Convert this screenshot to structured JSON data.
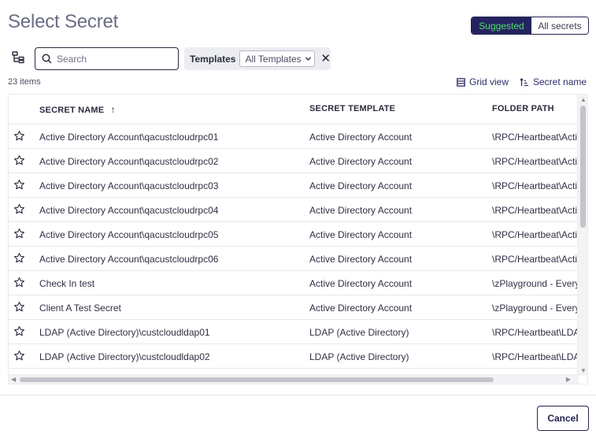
{
  "dialog": {
    "title": "Select Secret"
  },
  "toggle": {
    "suggested_label": "Suggested",
    "all_label": "All secrets"
  },
  "search": {
    "placeholder": "Search",
    "value": ""
  },
  "filter": {
    "label": "Templates",
    "selected": "All Templates"
  },
  "results": {
    "count_text": "23 items"
  },
  "view_controls": {
    "grid_view_label": "Grid view",
    "sort_label": "Secret name"
  },
  "table": {
    "columns": [
      "SECRET NAME",
      "SECRET TEMPLATE",
      "FOLDER PATH"
    ],
    "sort_indicator": "↑",
    "rows": [
      {
        "name": "Active Directory Account\\qacustcloudrpc01",
        "template": "Active Directory Account",
        "folder": "\\RPC/Heartbeat\\Active"
      },
      {
        "name": "Active Directory Account\\qacustcloudrpc02",
        "template": "Active Directory Account",
        "folder": "\\RPC/Heartbeat\\Active"
      },
      {
        "name": "Active Directory Account\\qacustcloudrpc03",
        "template": "Active Directory Account",
        "folder": "\\RPC/Heartbeat\\Active"
      },
      {
        "name": "Active Directory Account\\qacustcloudrpc04",
        "template": "Active Directory Account",
        "folder": "\\RPC/Heartbeat\\Active"
      },
      {
        "name": "Active Directory Account\\qacustcloudrpc05",
        "template": "Active Directory Account",
        "folder": "\\RPC/Heartbeat\\Active"
      },
      {
        "name": "Active Directory Account\\qacustcloudrpc06",
        "template": "Active Directory Account",
        "folder": "\\RPC/Heartbeat\\Active"
      },
      {
        "name": "Check In test",
        "template": "Active Directory Account",
        "folder": "\\zPlayground - Everyone"
      },
      {
        "name": "Client A Test Secret",
        "template": "Active Directory Account",
        "folder": "\\zPlayground - Everyone"
      },
      {
        "name": "LDAP (Active Directory)\\custcloudldap01",
        "template": "LDAP (Active Directory)",
        "folder": "\\RPC/Heartbeat\\LDAP"
      },
      {
        "name": "LDAP (Active Directory)\\custcloudldap02",
        "template": "LDAP (Active Directory)",
        "folder": "\\RPC/Heartbeat\\LDAP"
      }
    ]
  },
  "footer": {
    "cancel_label": "Cancel"
  },
  "colors": {
    "primary": "#242360",
    "suggested_text": "#4ee06a",
    "border": "#2c2d40"
  },
  "icons": {
    "tree": "folder-tree-icon",
    "search": "search-icon",
    "star": "star-outline-icon",
    "grid": "grid-view-icon",
    "sort": "sort-icon",
    "close": "close-icon",
    "chevron": "chevron-down-icon"
  }
}
